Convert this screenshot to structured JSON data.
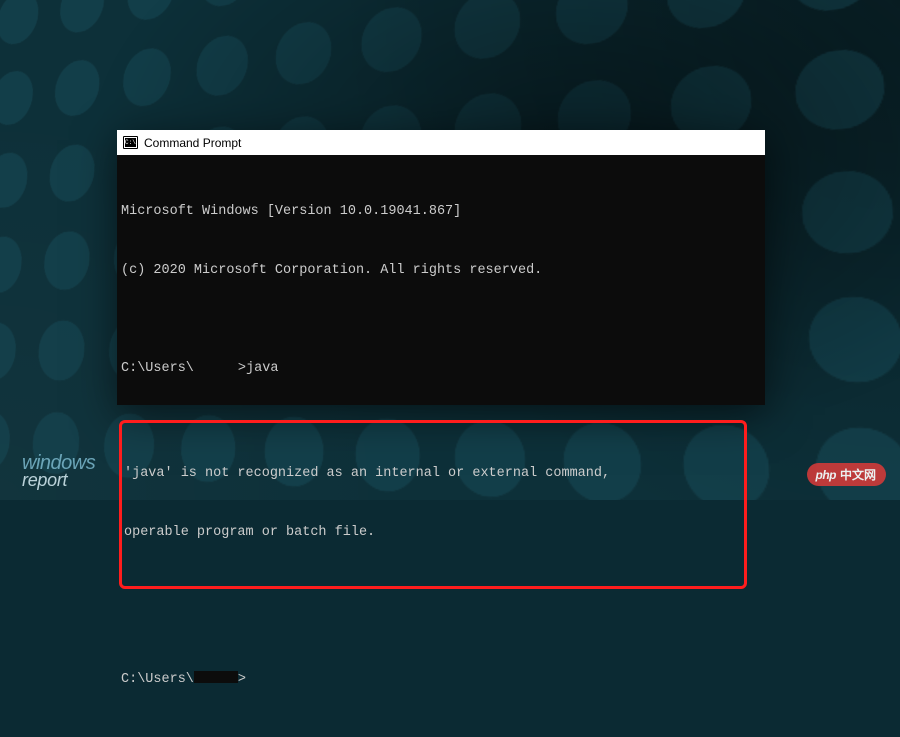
{
  "window": {
    "title": "Command Prompt"
  },
  "terminal": {
    "line1": "Microsoft Windows [Version 10.0.19041.867]",
    "line2": "(c) 2020 Microsoft Corporation. All rights reserved.",
    "blank": "",
    "prompt1_prefix": "C:\\Users\\",
    "prompt1_suffix": ">java",
    "error_line1": "'java' is not recognized as an internal or external command,",
    "error_line2": "operable program or batch file.",
    "prompt2_prefix": "C:\\Users\\",
    "prompt2_suffix": ">"
  },
  "watermarks": {
    "left_line1": "windows",
    "left_line2": "report",
    "right_logo": "php",
    "right_text": "中文网"
  }
}
